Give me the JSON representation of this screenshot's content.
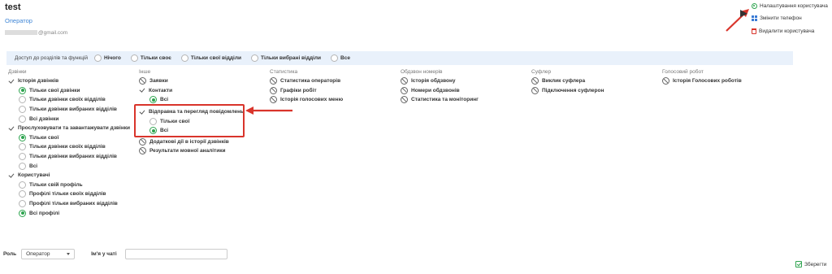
{
  "header": {
    "title": "test",
    "role": "Оператор",
    "email_suffix": "@gmail.com"
  },
  "actions": [
    {
      "label": "Налаштування користувача",
      "icon": "gear-icon"
    },
    {
      "label": "Змінити телефон",
      "icon": "grid-icon"
    },
    {
      "label": "Видалити користувача",
      "icon": "trash-icon"
    }
  ],
  "access": {
    "label": "Доступ до розділів та функцій",
    "options": [
      "Нічого",
      "Тільки своє",
      "Тільки свої відділи",
      "Тільки вибрані відділи",
      "Все"
    ]
  },
  "columns": {
    "calls": {
      "header": "Дзвінки",
      "items": [
        "Історія дзвінків",
        "Тільки свої дзвінки",
        "Тільки дзвінки своїх відділів",
        "Тільки дзвінки вибраних відділів",
        "Всі дзвінки",
        "Прослуховувати та завантажувати дзвінки",
        "Тільки свої",
        "Тільки дзвінки своїх відділів",
        "Тільки дзвінки вибраних відділів",
        "Всі",
        "Користувачі",
        "Тільки свій профіль",
        "Профілі тільки своїх відділів",
        "Профілі тільки вибраних відділів",
        "Всі профілі"
      ]
    },
    "other": {
      "header": "Інше",
      "items": [
        "Заявки",
        "Контакти",
        "Всі",
        "Відправка та перегляд повідомлень",
        "Тільки свої",
        "Всі",
        "Додаткові дії в історії дзвінків",
        "Результати мовної аналітики"
      ]
    },
    "stats": {
      "header": "Статистика",
      "items": [
        "Статистика операторів",
        "Графіки робіт",
        "Історія голосових меню"
      ]
    },
    "dialer": {
      "header": "Обдзвон номерів",
      "items": [
        "Історія обдзвону",
        "Номери обдзвонів",
        "Статистика та моніторинг"
      ]
    },
    "prompter": {
      "header": "Суфлер",
      "items": [
        "Виклик суфлера",
        "Підключення суфлерон"
      ]
    },
    "robot": {
      "header": "Голосовий робот",
      "items": [
        "Історія Голосових роботів"
      ]
    }
  },
  "footer": {
    "role_label": "Роль",
    "role_value": "Оператор",
    "chat_name_label": "Ім'я у чаті",
    "chat_name_value": "",
    "save_label": "Зберегти"
  },
  "colors": {
    "accent_green": "#2ea44f",
    "link_blue": "#3f86d6",
    "highlight_red": "#d9342b",
    "bar_bg": "#e9f1fb"
  }
}
